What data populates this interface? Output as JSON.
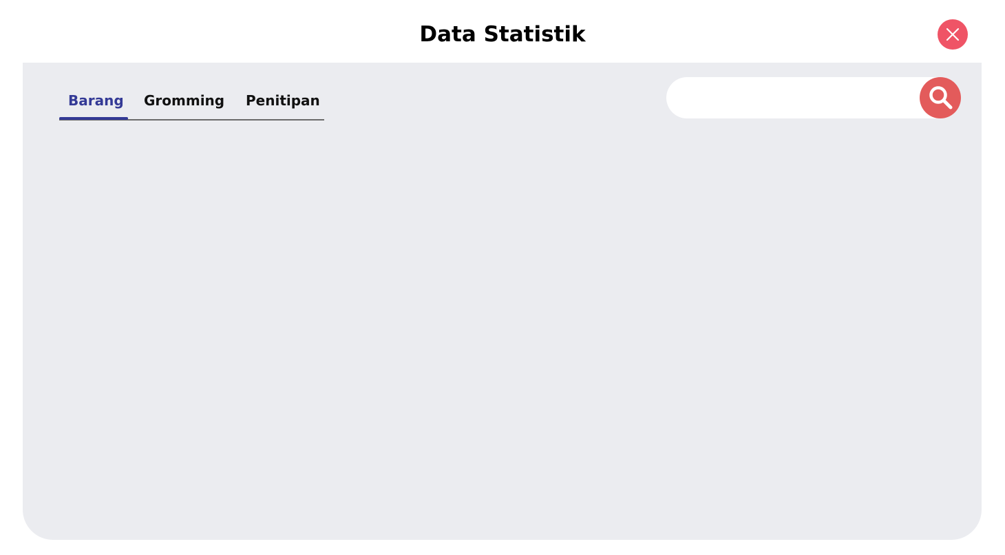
{
  "header": {
    "title": "Data Statistik",
    "close_icon": "close-icon"
  },
  "tabs": [
    {
      "label": "Barang",
      "active": true
    },
    {
      "label": "Gromming",
      "active": false
    },
    {
      "label": "Penitipan",
      "active": false
    }
  ],
  "search": {
    "value": "",
    "placeholder": "",
    "button_icon": "search-icon"
  },
  "colors": {
    "accent": "#343a96",
    "close_button": "#ef5466",
    "search_button": "#e35b5b",
    "panel_background": "#ebecf0"
  }
}
